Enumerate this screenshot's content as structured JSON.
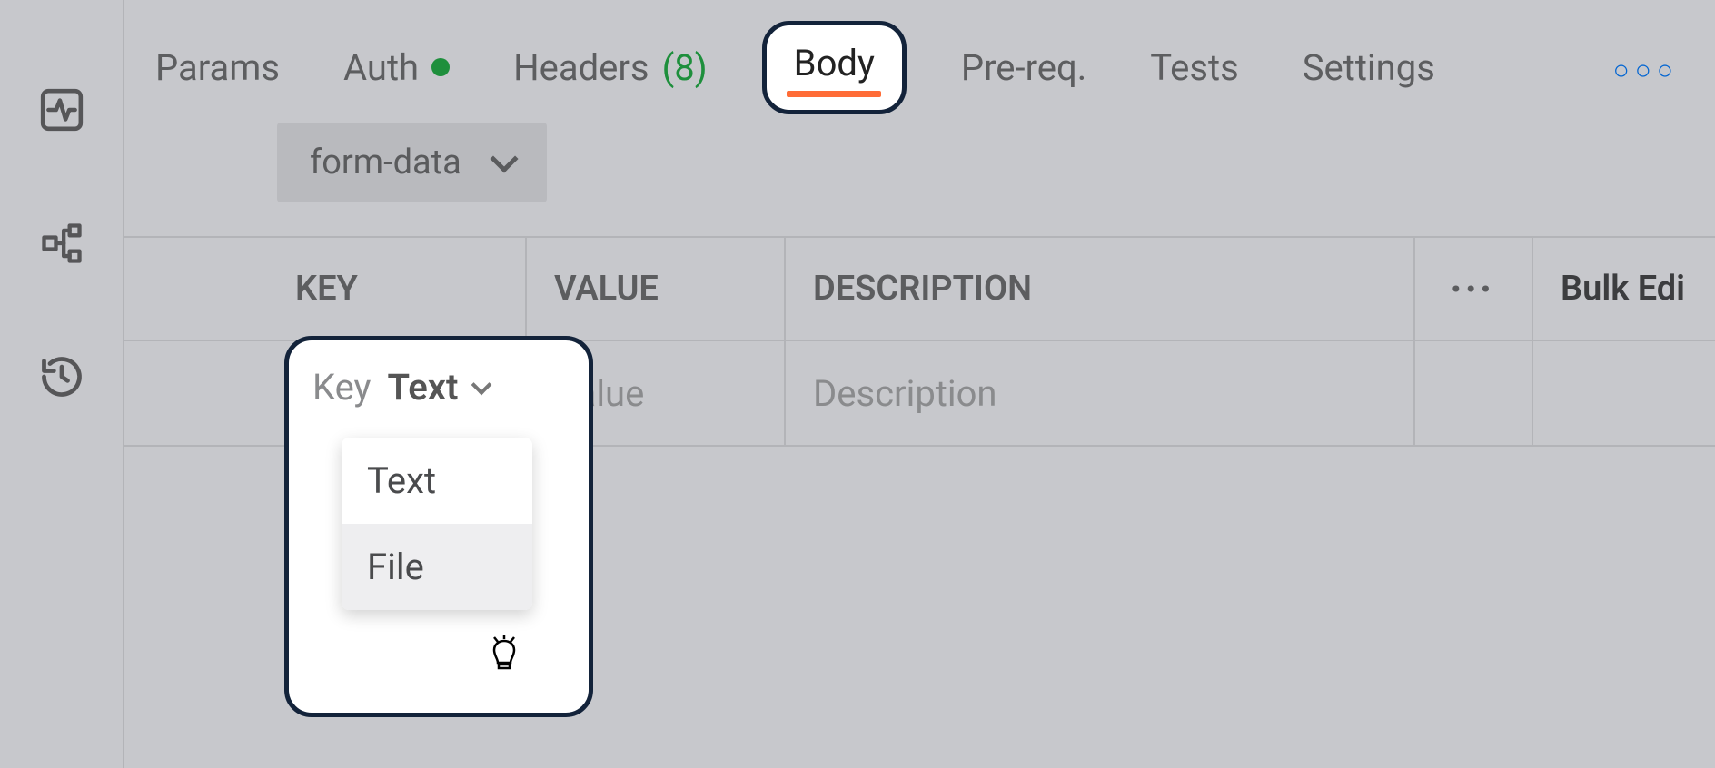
{
  "tabs": {
    "params": "Params",
    "auth": "Auth",
    "headers": "Headers",
    "headers_count": "(8)",
    "body": "Body",
    "prereq": "Pre-req.",
    "tests": "Tests",
    "settings": "Settings"
  },
  "body_type": "form-data",
  "table": {
    "headers": {
      "key": "KEY",
      "value": "VALUE",
      "description": "DESCRIPTION"
    },
    "bulk_edit": "Bulk Edi",
    "row": {
      "key_placeholder": "Key",
      "key_type": "Text",
      "value_placeholder": "Value",
      "description_placeholder": "Description"
    }
  },
  "dropdown": {
    "options": [
      "Text",
      "File"
    ]
  }
}
